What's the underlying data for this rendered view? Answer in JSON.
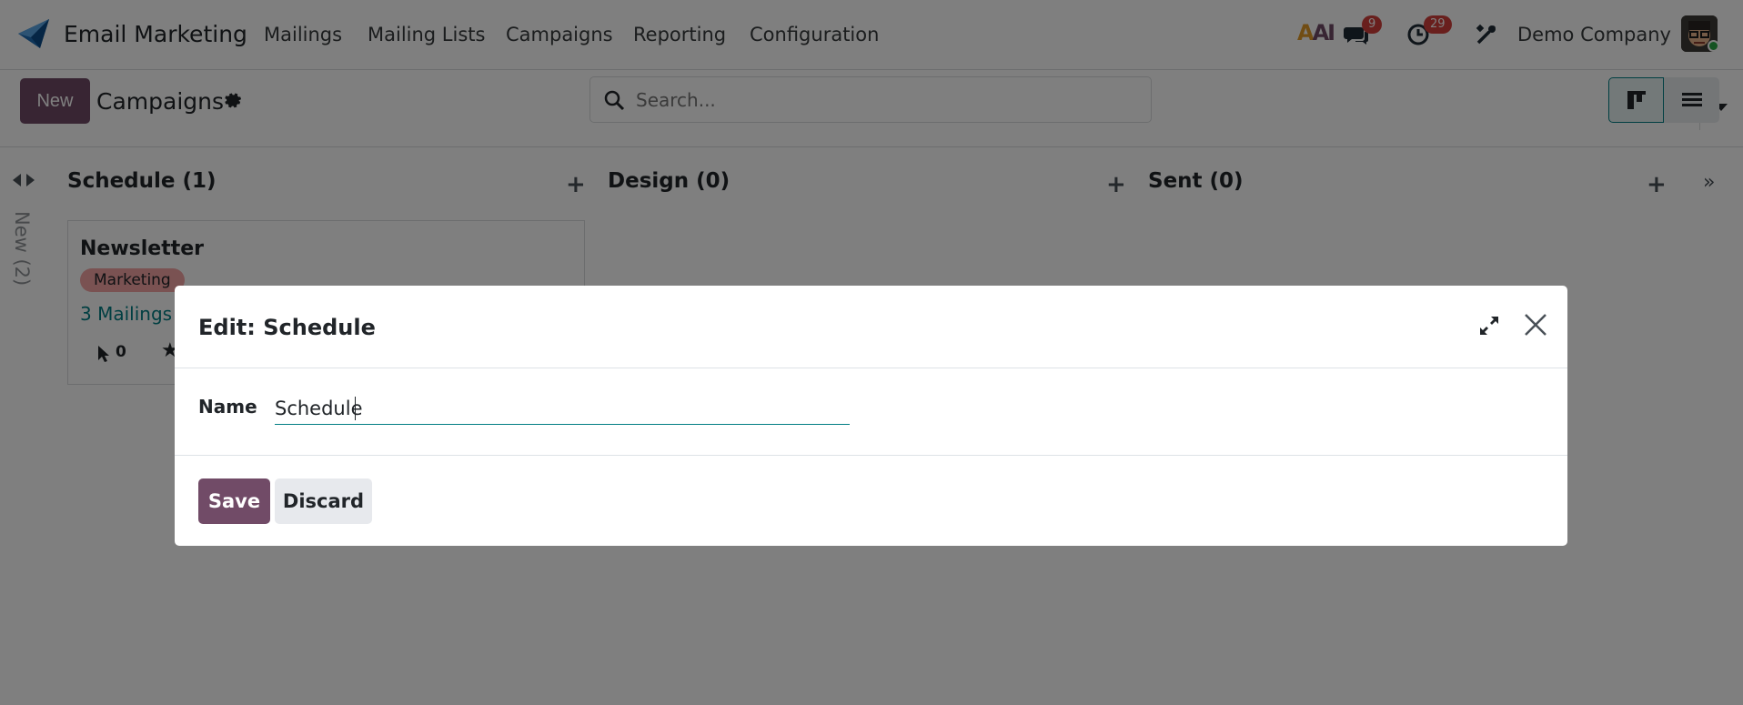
{
  "navbar": {
    "app_title": "Email Marketing",
    "menu": [
      "Mailings",
      "Mailing Lists",
      "Campaigns",
      "Reporting",
      "Configuration"
    ],
    "ai_label": "AI",
    "messages_count": "9",
    "activities_count": "29",
    "company": "Demo Company"
  },
  "control": {
    "new_label": "New",
    "breadcrumb": "Campaigns",
    "search_placeholder": "Search..."
  },
  "kanban": {
    "folded_column": "New (2)",
    "columns": [
      {
        "title": "Schedule (1)"
      },
      {
        "title": "Design (0)"
      },
      {
        "title": "Sent (0)"
      }
    ],
    "card": {
      "title": "Newsletter",
      "tag": "Marketing",
      "mailings": "3 Mailings",
      "clicks": "0"
    }
  },
  "dialog": {
    "title": "Edit: Schedule",
    "name_label": "Name",
    "name_value": "Schedule",
    "save_label": "Save",
    "discard_label": "Discard"
  },
  "colors": {
    "primary": "#714b67",
    "accent": "#017e84",
    "badge": "#d23f3a"
  }
}
